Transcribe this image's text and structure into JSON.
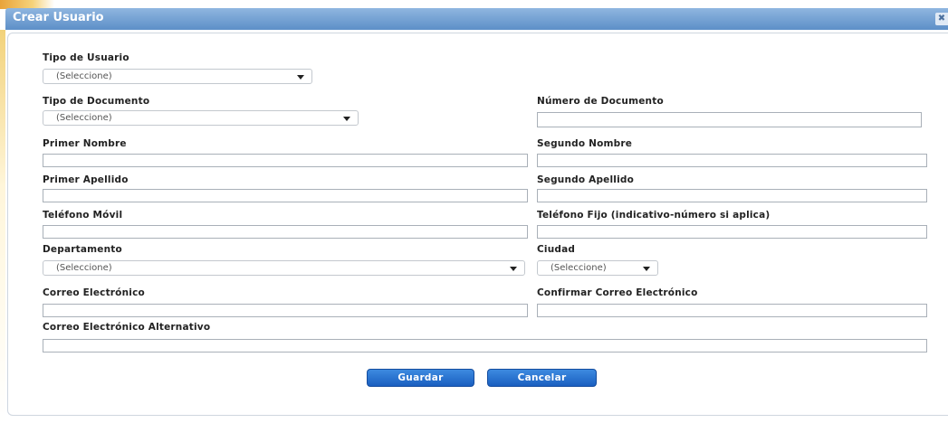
{
  "dialog": {
    "title": "Crear Usuario",
    "close_label": "✖"
  },
  "form": {
    "tipo_usuario": {
      "label": "Tipo de Usuario",
      "value": "(Seleccione)"
    },
    "tipo_documento": {
      "label": "Tipo de Documento",
      "value": "(Seleccione)"
    },
    "numero_documento": {
      "label": "Número de Documento",
      "value": ""
    },
    "primer_nombre": {
      "label": "Primer Nombre",
      "value": ""
    },
    "segundo_nombre": {
      "label": "Segundo Nombre",
      "value": ""
    },
    "primer_apellido": {
      "label": "Primer Apellido",
      "value": ""
    },
    "segundo_apellido": {
      "label": "Segundo Apellido",
      "value": ""
    },
    "telefono_movil": {
      "label": "Teléfono Móvil",
      "value": ""
    },
    "telefono_fijo": {
      "label": "Teléfono Fijo (indicativo-número si aplica)",
      "value": ""
    },
    "departamento": {
      "label": "Departamento",
      "value": "(Seleccione)"
    },
    "ciudad": {
      "label": "Ciudad",
      "value": "(Seleccione)"
    },
    "correo": {
      "label": "Correo Electrónico",
      "value": ""
    },
    "confirmar_correo": {
      "label": "Confirmar Correo Electrónico",
      "value": ""
    },
    "correo_alternativo": {
      "label": "Correo Electrónico Alternativo",
      "value": ""
    }
  },
  "buttons": {
    "save_label": "Guardar",
    "cancel_label": "Cancelar"
  },
  "colors": {
    "titlebar": "#5d8fc8",
    "button": "#1a5fc0",
    "accent_edge": "#e8a33a"
  }
}
